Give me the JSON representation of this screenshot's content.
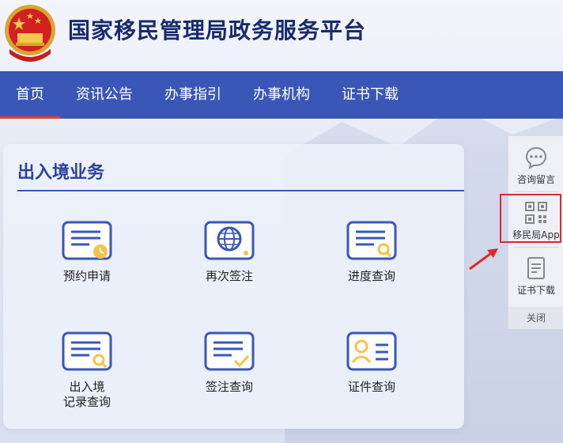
{
  "header": {
    "title": "国家移民管理局政务服务平台"
  },
  "nav": {
    "items": [
      {
        "label": "首页"
      },
      {
        "label": "资讯公告"
      },
      {
        "label": "办事指引"
      },
      {
        "label": "办事机构"
      },
      {
        "label": "证书下载"
      }
    ],
    "active_index": 0
  },
  "panel": {
    "title": "出入境业务",
    "services": [
      {
        "label": "预约申请",
        "icon": "appointment-icon"
      },
      {
        "label": "再次签注",
        "icon": "globe-icon"
      },
      {
        "label": "进度查询",
        "icon": "progress-search-icon"
      },
      {
        "label": "出入境\n记录查询",
        "icon": "record-search-icon"
      },
      {
        "label": "签注查询",
        "icon": "endorsement-check-icon"
      },
      {
        "label": "证件查询",
        "icon": "id-card-icon"
      }
    ]
  },
  "float_bar": {
    "consult": "咨询留言",
    "app": "移民局App",
    "download": "证书下载",
    "close": "关闭"
  },
  "colors": {
    "nav_bg": "#3a57b8",
    "accent_red": "#e0282e",
    "title_blue": "#2d3f9e"
  }
}
